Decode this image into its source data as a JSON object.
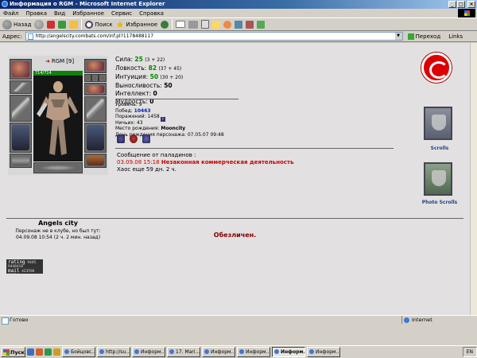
{
  "window": {
    "title": "Информация о RGM - Microsoft Internet Explorer",
    "controls": [
      "_",
      "□",
      "×"
    ]
  },
  "menu": [
    "Файл",
    "Правка",
    "Вид",
    "Избранное",
    "Сервис",
    "Справка"
  ],
  "toolbar": {
    "back": "Назад",
    "search": "Поиск",
    "favorites": "Избранное"
  },
  "address": {
    "label": "Адрес:",
    "url": "http://angelscity.combats.com/inf.pl?1178488117",
    "go": "Переход",
    "links": "Links"
  },
  "character": {
    "nick": "RGM",
    "level": "[9]",
    "info_badge": "i",
    "hp": "714/714",
    "city": "Angels city",
    "club_note_line1": "Персонаж не в клубе, но был тут:",
    "club_note_line2": "04.09.08 10:54 (2 ч. 2 мин. назад)"
  },
  "stats": [
    {
      "label": "Сила:",
      "value": "25",
      "bonus": "(3 + 22)",
      "green": true
    },
    {
      "label": "Ловкость:",
      "value": "82",
      "bonus": "(37 + 45)",
      "green": true
    },
    {
      "label": "Интуиция:",
      "value": "50",
      "bonus": "(30 + 20)",
      "green": true
    },
    {
      "label": "Выносливость:",
      "value": "50",
      "bonus": "",
      "green": false
    },
    {
      "label": "Интеллект:",
      "value": "0",
      "bonus": "",
      "green": false
    },
    {
      "label": "Мудрость:",
      "value": "0",
      "bonus": "",
      "green": false
    }
  ],
  "info": {
    "level_label": "Уровень:",
    "level": "9",
    "wins_label": "Побед:",
    "wins": "10463",
    "losses_label": "Поражений:",
    "losses": "1458",
    "draws_label": "Ничьих:",
    "draws": "43",
    "birthplace_label": "Место рождения:",
    "birthplace": "Mooncity",
    "birthday_label": "День рождения персонажа:",
    "birthday": "07.05.07 09:48"
  },
  "paladin": {
    "header": "Сообщение от паладинов :",
    "date": "03.09.08 15:18",
    "reason": "Незаконная коммерческая деятельность",
    "chaos": "Хаос еще 59 дн. 2 ч."
  },
  "right_panel": {
    "scrolls": "Scrolls",
    "photo_scrolls": "Photo Scrolls"
  },
  "banned": "Обезличен.",
  "counter": {
    "brand": "rating",
    "line1": "9445 9448418",
    "line2": "mail",
    "line3": "423596",
    "line4": "26634"
  },
  "statusbar": {
    "left": "Готово",
    "right": "Internet"
  },
  "taskbar": {
    "start": "Пуск",
    "tasks": [
      "Бойцовс...",
      "http://su...",
      "Информ...",
      "17. Mari...",
      "Информ...",
      "Информ...",
      "Информ...",
      "Информ..."
    ],
    "active_index": 6,
    "tray": "EN"
  },
  "colors": {
    "stat_green": "#008800",
    "paladin_red": "#cc0000",
    "banned_maroon": "#800000",
    "hp_green": "#108010"
  }
}
